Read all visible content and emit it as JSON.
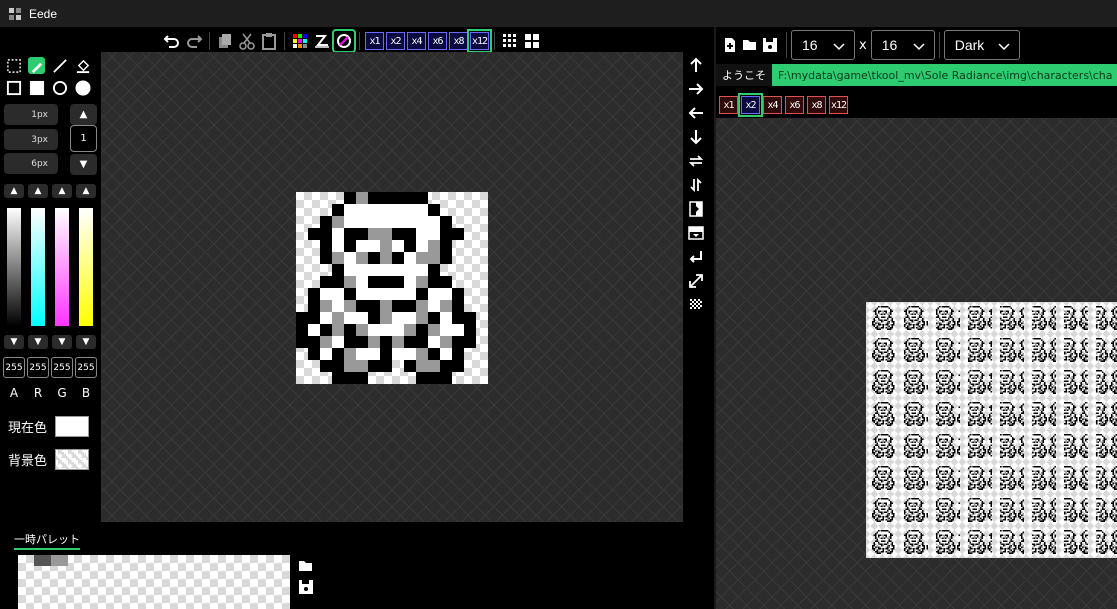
{
  "window": {
    "title": "Eede"
  },
  "toolbar": {
    "icons": [
      "undo-icon",
      "redo-icon",
      "copy-icon",
      "cut-icon",
      "paste-icon",
      "palette-grid-icon",
      "color-swap-icon",
      "color-pick-icon"
    ],
    "zoom_labels": [
      "x1",
      "x2",
      "x4",
      "x6",
      "x8",
      "x12"
    ],
    "active_zoom": "x12"
  },
  "tools": {
    "pen_sizes": [
      "1px",
      "3px",
      "6px"
    ],
    "pen_size_value": "1"
  },
  "color_sliders": {
    "values": [
      "255",
      "255",
      "255",
      "255"
    ],
    "labels": [
      "A",
      "R",
      "G",
      "B"
    ],
    "colors": [
      "#ffffff",
      "#00ffff",
      "#ff33ff",
      "#ffff00"
    ]
  },
  "colors": {
    "current_label": "現在色",
    "background_label": "背景色",
    "current_value": "#ffffff"
  },
  "palette": {
    "title": "一時パレット"
  },
  "right_panel": {
    "width_value": "16",
    "height_value": "16",
    "times": "x",
    "theme_value": "Dark",
    "tabs": {
      "welcome": "ようこそ",
      "file": "F:\\mydata\\game\\tkool_mv\\Sole Radiance\\img\\characters\\cha"
    },
    "zoom_labels": [
      "x1",
      "x2",
      "x4",
      "x6",
      "x8",
      "x12"
    ],
    "active_zoom": "x2"
  },
  "accent_color": "#2ecc71"
}
